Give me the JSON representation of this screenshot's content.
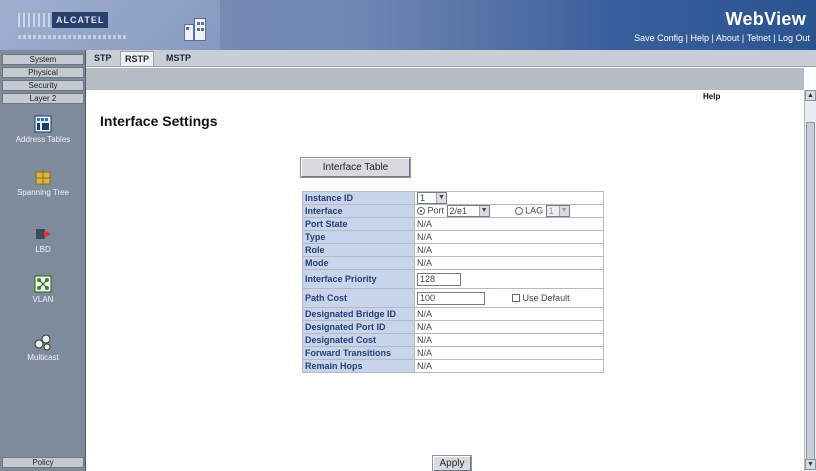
{
  "header": {
    "app_title": "WebView",
    "logo_brand": "ALCATEL",
    "links": [
      "Save Config",
      "Help",
      "About",
      "Telnet",
      "Log Out"
    ]
  },
  "nav": {
    "top_buttons": [
      "System",
      "Physical",
      "Security",
      "Layer 2"
    ],
    "items": [
      "Address Tables",
      "Spanning Tree",
      "LBD",
      "VLAN",
      "Multicast"
    ],
    "bottom_button": "Policy"
  },
  "tabs": [
    "STP",
    "RSTP",
    "MSTP"
  ],
  "active_tab": "RSTP",
  "help_label": "Help",
  "page_title": "Interface Settings",
  "interface_table_button": "Interface Table",
  "form": {
    "instance_id": {
      "label": "Instance ID",
      "value": "1"
    },
    "interface": {
      "label": "Interface",
      "port_label": "Port",
      "port_value": "2/e1",
      "lag_label": "LAG",
      "lag_value": "1",
      "selected": "Port"
    },
    "port_state": {
      "label": "Port State",
      "value": "N/A"
    },
    "type": {
      "label": "Type",
      "value": "N/A"
    },
    "role": {
      "label": "Role",
      "value": "N/A"
    },
    "mode": {
      "label": "Mode",
      "value": "N/A"
    },
    "interface_priority": {
      "label": "Interface Priority",
      "value": "128"
    },
    "path_cost": {
      "label": "Path Cost",
      "value": "100",
      "use_default_label": "Use Default",
      "use_default_checked": false
    },
    "designated_bridge_id": {
      "label": "Designated Bridge ID",
      "value": "N/A"
    },
    "designated_port_id": {
      "label": "Designated Port ID",
      "value": "N/A"
    },
    "designated_cost": {
      "label": "Designated Cost",
      "value": "N/A"
    },
    "forward_transitions": {
      "label": "Forward Transitions",
      "value": "N/A"
    },
    "remain_hops": {
      "label": "Remain Hops",
      "value": "N/A"
    }
  },
  "apply_label": "Apply",
  "colors": {
    "header_dark": "#2a548f",
    "label_bg": "#c7d4e9",
    "label_text": "#263f73"
  }
}
